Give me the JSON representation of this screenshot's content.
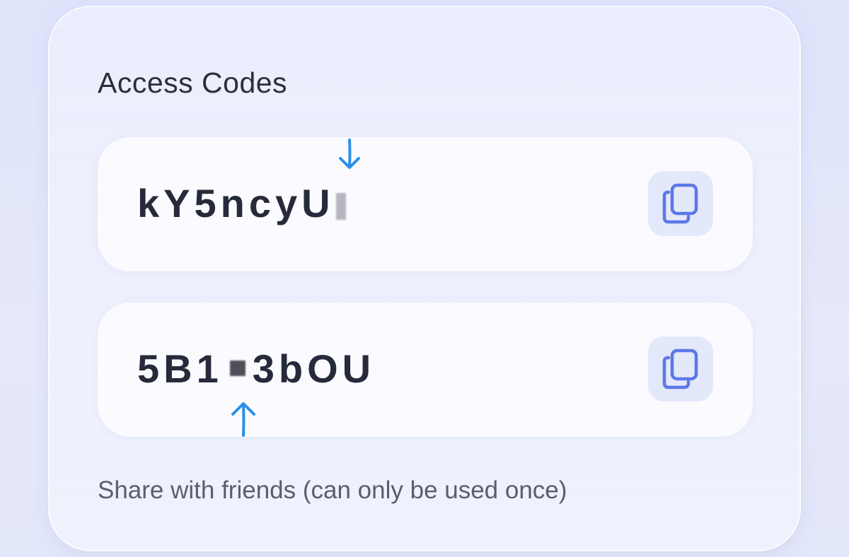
{
  "panel": {
    "title": "Access Codes",
    "footer_text": "Share with friends (can only be used once)"
  },
  "codes": [
    {
      "text": "kY5ncyU",
      "copy_icon": "copy-icon"
    },
    {
      "text_before": "5B1",
      "text_after": "3bOU",
      "copy_icon": "copy-icon"
    }
  ],
  "annotations": {
    "arrow_color": "#2b8fe8",
    "first_arrow": "arrow-down-icon",
    "second_arrow": "arrow-up-icon"
  },
  "colors": {
    "accent": "#5b78e6",
    "copy_button_bg": "#e4e8fb",
    "code_text": "#262a3b"
  }
}
